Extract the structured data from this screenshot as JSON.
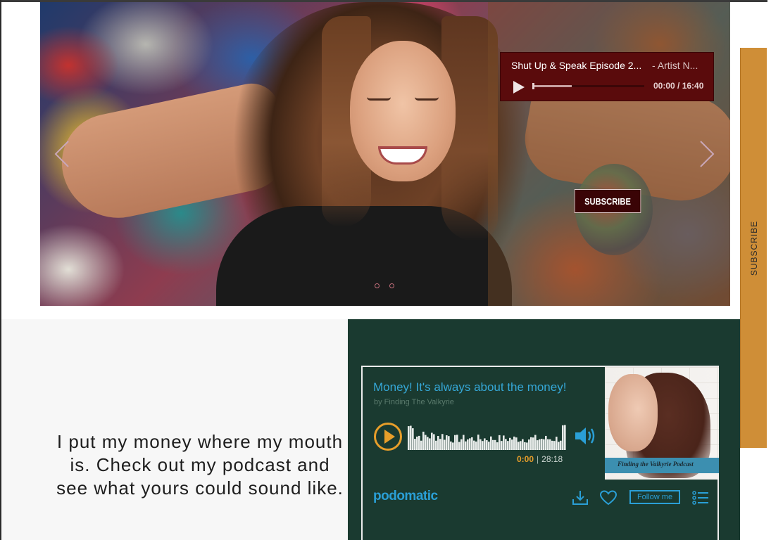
{
  "hero": {
    "audio_player": {
      "title": "Shut Up & Speak Episode 2...",
      "artist": "- Artist N...",
      "time": "00:00 / 16:40",
      "progress_fraction": 0.35
    },
    "subscribe_label": "SUBSCRIBE"
  },
  "side_tab": {
    "label": "SUBSCRIBE"
  },
  "quote": {
    "text": "I put my money where my mouth is. Check out my podcast and see what yours could sound like."
  },
  "podcast_widget": {
    "title": "Money! It's always about the money!",
    "byline": "by Finding The Valkyrie",
    "current_time": "0:00",
    "separator": "|",
    "duration": "28:18",
    "cover_caption": "Finding the Valkyrie Podcast",
    "logo": "podomatic",
    "follow_label": "Follow me",
    "icons": [
      "play-icon",
      "volume-icon",
      "download-icon",
      "heart-icon",
      "playlist-icon"
    ]
  },
  "colors": {
    "player_bg": "#5a0b0c",
    "side_tab": "#cf8e37",
    "widget_bg": "#1a3a30",
    "accent_orange": "#e79e2a",
    "accent_blue": "#2a9fd6"
  }
}
